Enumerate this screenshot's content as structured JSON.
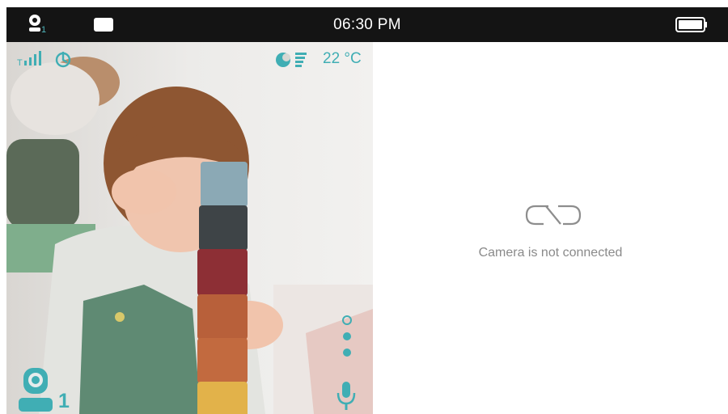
{
  "status_bar": {
    "camera_number": "1",
    "time": "06:30 PM"
  },
  "video_panel": {
    "temperature": "22 °C",
    "camera_label": "1"
  },
  "right_panel": {
    "message": "Camera is not connected"
  },
  "colors": {
    "accent": "#40aeb4",
    "status_bar_bg": "#141414"
  },
  "icons": [
    "camera-icon",
    "screen-icon",
    "battery-icon",
    "signal-icon",
    "vox-icon",
    "night-light-icon",
    "temperature-bars-icon",
    "camera-unit-icon",
    "microphone-icon",
    "disconnected-icon"
  ]
}
